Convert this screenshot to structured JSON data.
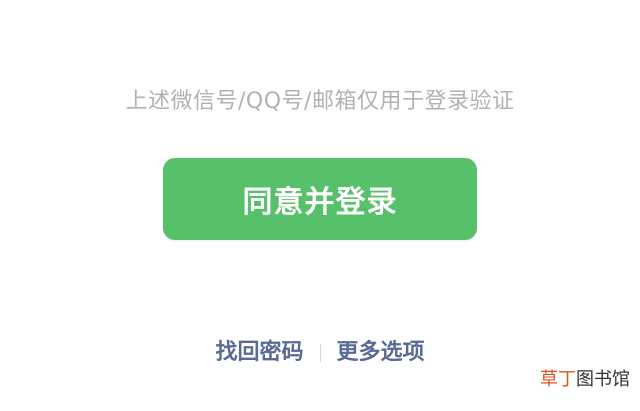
{
  "notice": {
    "text": "上述微信号/QQ号/邮箱仅用于登录验证"
  },
  "actions": {
    "agree_login_label": "同意并登录"
  },
  "footer_links": {
    "recover_password": "找回密码",
    "more_options": "更多选项"
  },
  "watermark": {
    "accent_part": "草丁",
    "rest": "图书馆"
  },
  "colors": {
    "button_green": "#57c06b",
    "link_blue": "#576b95",
    "hint_gray": "#b2b2b2",
    "watermark_accent": "#d9541e"
  }
}
